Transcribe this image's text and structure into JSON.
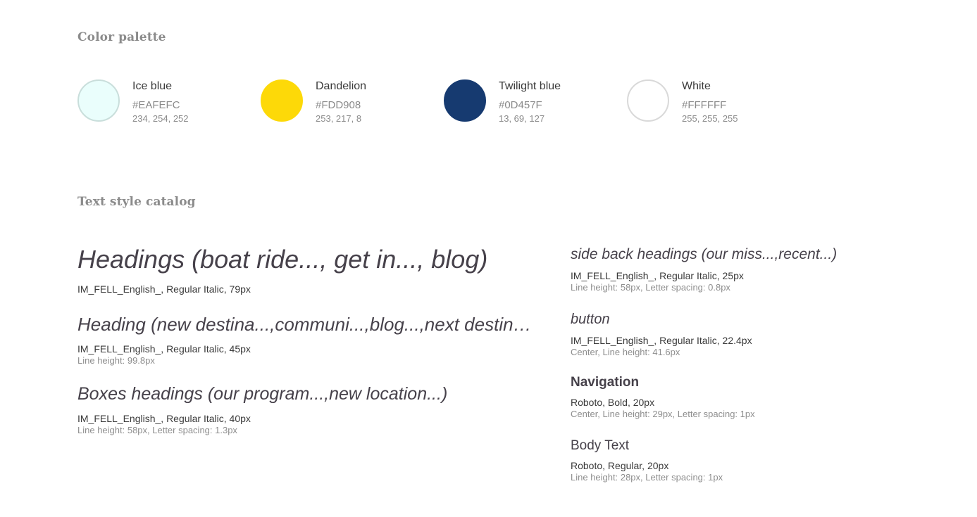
{
  "sections": {
    "palette_title": "Color palette",
    "catalog_title": "Text style catalog"
  },
  "palette": [
    {
      "name": "Ice blue",
      "hex": "#EAFEFC",
      "rgb": "234, 254, 252",
      "fill": "#EAFEFC",
      "border": "#C9DEDB"
    },
    {
      "name": "Dandelion",
      "hex": "#FDD908",
      "rgb": "253, 217, 8",
      "fill": "#FDD908",
      "border": "#FDD908"
    },
    {
      "name": "Twilight blue",
      "hex": "#0D457F",
      "rgb": "13, 69, 127",
      "fill": "#163A70",
      "border": "#163A70"
    },
    {
      "name": "White",
      "hex": "#FFFFFF",
      "rgb": "255, 255, 255",
      "fill": "#FFFFFF",
      "border": "#D9D9D9"
    }
  ],
  "text_styles": {
    "left": [
      {
        "sample": "Headings (boat ride..., get in..., blog)",
        "meta": "IM_FELL_English_, Regular Italic, 79px",
        "detail": ""
      },
      {
        "sample": "Heading (new destina...,communi...,blog...,next destin…",
        "meta": "IM_FELL_English_, Regular Italic, 45px",
        "detail": "Line height: 99.8px"
      },
      {
        "sample": "Boxes headings (our program...,new location...)",
        "meta": "IM_FELL_English_, Regular Italic, 40px",
        "detail": "Line height: 58px, Letter spacing: 1.3px"
      }
    ],
    "right": [
      {
        "sample": "side back headings (our miss...,recent...)",
        "meta": "IM_FELL_English_, Regular Italic, 25px",
        "detail": "Line height: 58px, Letter spacing: 0.8px"
      },
      {
        "sample": "button",
        "meta": "IM_FELL_English_, Regular Italic, 22.4px",
        "detail": "Center, Line height: 41.6px"
      },
      {
        "sample": "Navigation",
        "meta": "Roboto, Bold, 20px",
        "detail": "Center, Line height: 29px, Letter spacing: 1px"
      },
      {
        "sample": "Body Text",
        "meta": "Roboto, Regular, 20px",
        "detail": "Line height: 28px, Letter spacing: 1px"
      }
    ]
  }
}
